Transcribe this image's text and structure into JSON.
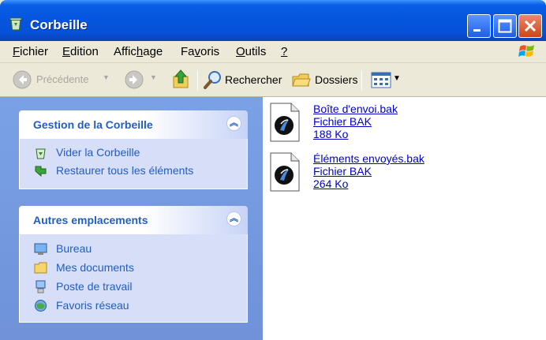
{
  "window": {
    "title": "Corbeille",
    "icon": "recycle-bin-icon"
  },
  "menu": [
    {
      "label": "Fichier",
      "underline": "F"
    },
    {
      "label": "Edition",
      "underline": "E"
    },
    {
      "label": "Affichage",
      "underline": "h"
    },
    {
      "label": "Favoris",
      "underline": "v"
    },
    {
      "label": "Outils",
      "underline": "O"
    },
    {
      "label": "?",
      "underline": "?"
    }
  ],
  "toolbar": {
    "back_label": "Précédente",
    "search_label": "Rechercher",
    "folders_label": "Dossiers"
  },
  "tasks_panel": {
    "title": "Gestion de la Corbeille",
    "items": [
      {
        "label": "Vider la Corbeille",
        "icon": "empty-bin-icon"
      },
      {
        "label": "Restaurer tous les éléments",
        "icon": "restore-icon"
      }
    ]
  },
  "places_panel": {
    "title": "Autres emplacements",
    "items": [
      {
        "label": "Bureau",
        "icon": "desktop-icon"
      },
      {
        "label": "Mes documents",
        "icon": "my-documents-icon"
      },
      {
        "label": "Poste de travail",
        "icon": "my-computer-icon"
      },
      {
        "label": "Favoris réseau",
        "icon": "network-places-icon"
      }
    ]
  },
  "files": [
    {
      "name": "Boîte d'envoi.bak",
      "type": "Fichier BAK",
      "size": "188 Ko"
    },
    {
      "name": "Éléments envoyés.bak",
      "type": "Fichier BAK",
      "size": "264 Ko"
    }
  ],
  "colors": {
    "title_bar": "#0655de",
    "task_link": "#215dc6",
    "file_link": "#0000cc",
    "left_pane": "#7aa1e6"
  }
}
